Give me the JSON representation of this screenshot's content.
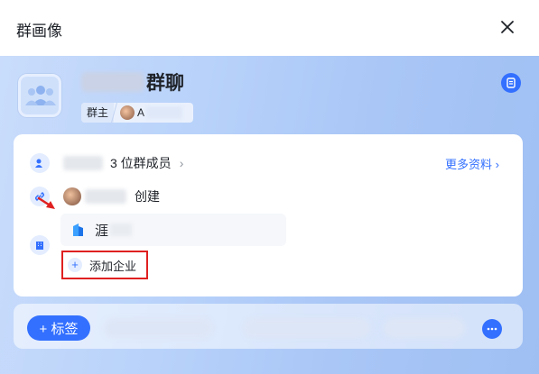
{
  "header": {
    "title": "群画像"
  },
  "group": {
    "name_suffix": "群聊",
    "owner_label": "群主",
    "owner_name_first_char": "A"
  },
  "card": {
    "members_text": "3 位群成员",
    "more_info": "更多资料 ›",
    "created_text": "创建",
    "org_text": "涯",
    "add_org_label": "添加企业"
  },
  "bottom": {
    "tag_button": "+ 标签"
  },
  "colors": {
    "accent": "#3370ff",
    "highlight_border": "#e02020"
  }
}
